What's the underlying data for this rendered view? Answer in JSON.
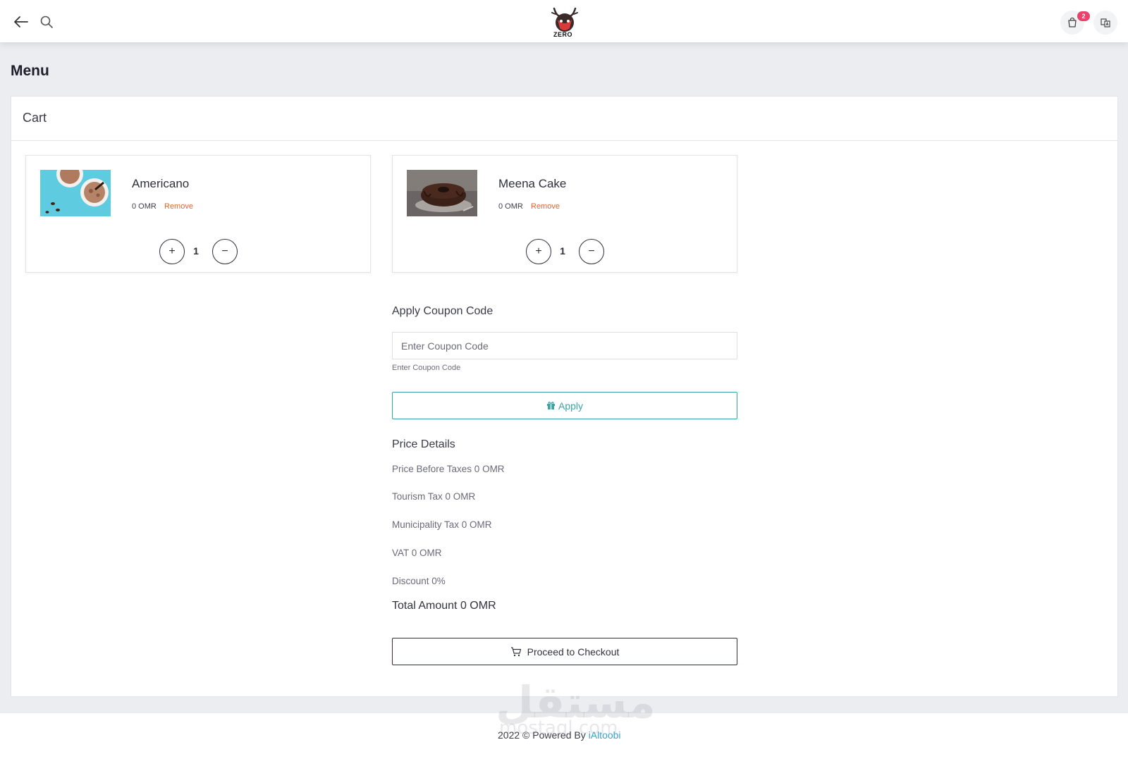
{
  "header": {
    "logo_text": "ZERO",
    "cart_badge_count": "2"
  },
  "page": {
    "title": "Menu"
  },
  "cart": {
    "title": "Cart",
    "items": [
      {
        "name": "Americano",
        "price": "0 OMR",
        "remove_label": "Remove",
        "quantity": "1"
      },
      {
        "name": "Meena Cake",
        "price": "0 OMR",
        "remove_label": "Remove",
        "quantity": "1"
      }
    ]
  },
  "coupon": {
    "title": "Apply Coupon Code",
    "placeholder": "Enter Coupon Code",
    "hint": "Enter Coupon Code",
    "apply_label": "Apply"
  },
  "price_details": {
    "title": "Price Details",
    "before_taxes": "Price Before Taxes 0 OMR",
    "tourism_tax": "Tourism Tax 0 OMR",
    "municipality_tax": "Municipality Tax 0 OMR",
    "vat": "VAT 0 OMR",
    "discount": "Discount 0%",
    "total": "Total Amount 0 OMR"
  },
  "checkout": {
    "label": "Proceed to Checkout"
  },
  "footer": {
    "text": "2022 © Powered By",
    "link": "iAltoobi",
    "watermark": "مستقل",
    "watermark_latin": "mostaql.com"
  },
  "colors": {
    "accent_teal": "#3aa3a6",
    "remove_orange": "#d9692e",
    "badge_pink": "#e9426b",
    "footer_link": "#3aa3c9"
  },
  "icons": {
    "back": "arrow-left-icon",
    "search": "search-icon",
    "cart": "shopping-bag-icon",
    "language": "translate-icon",
    "apply": "gift-icon",
    "checkout": "shopping-cart-icon"
  }
}
